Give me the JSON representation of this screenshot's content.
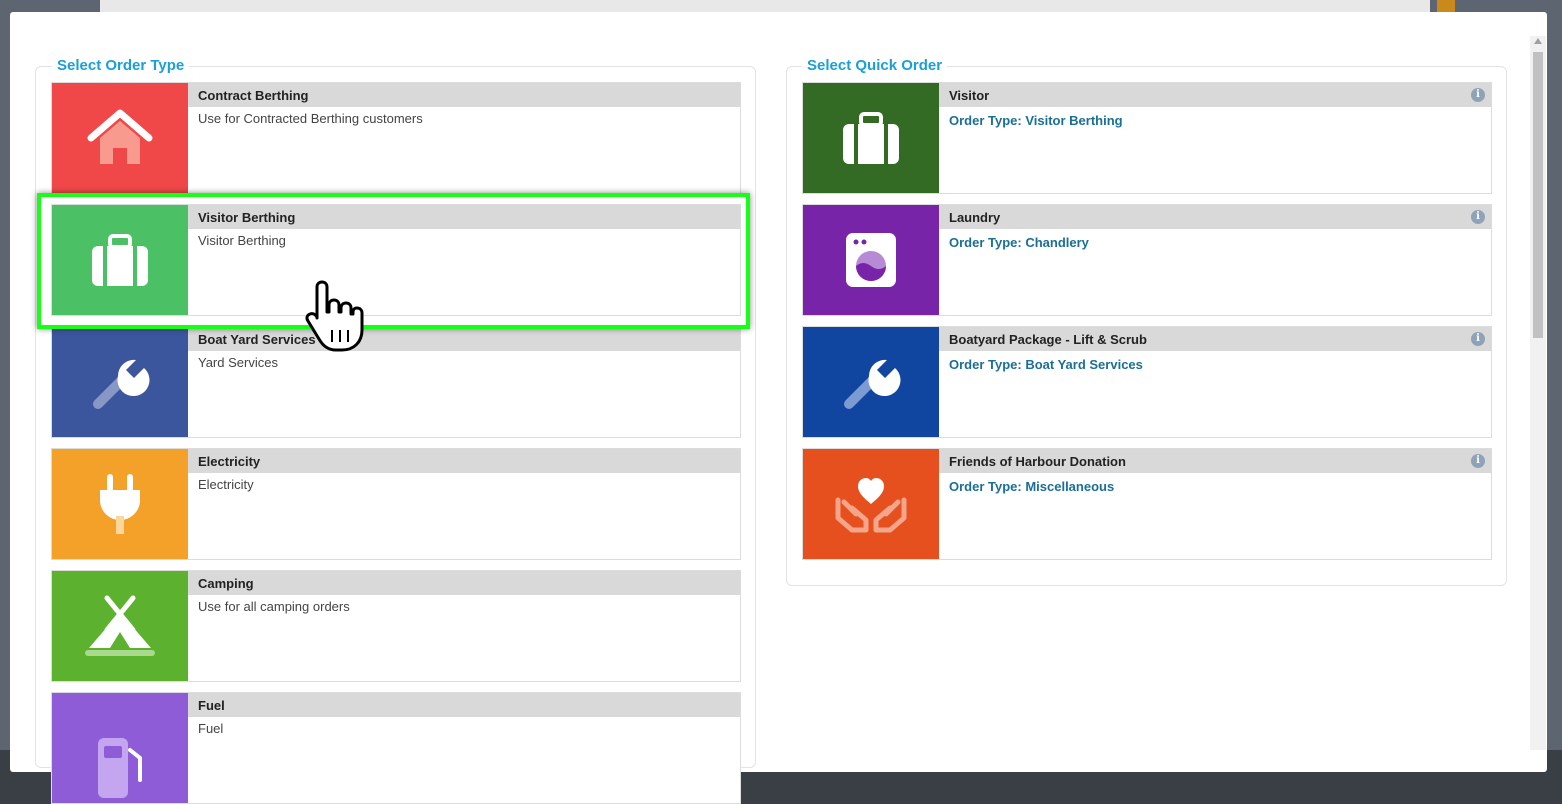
{
  "order_types": {
    "heading": "Select Order Type",
    "items": [
      {
        "title": "Contract Berthing",
        "description": "Use for Contracted Berthing customers",
        "color": "#f04848",
        "icon": "house-icon"
      },
      {
        "title": "Visitor Berthing",
        "description": "Visitor Berthing",
        "color": "#4cc064",
        "icon": "suitcase-icon"
      },
      {
        "title": "Boat Yard Services",
        "description": "Yard Services",
        "color": "#3c569e",
        "icon": "wrench-icon"
      },
      {
        "title": "Electricity",
        "description": "Electricity",
        "color": "#f4a12a",
        "icon": "plug-icon"
      },
      {
        "title": "Camping",
        "description": "Use for all camping orders",
        "color": "#5cb12f",
        "icon": "tent-icon"
      },
      {
        "title": "Fuel",
        "description": "Fuel",
        "color": "#8f5cd7",
        "icon": "fuel-pump-icon"
      }
    ]
  },
  "quick_orders": {
    "heading": "Select Quick Order",
    "items": [
      {
        "title": "Visitor",
        "order_type": "Order Type: Visitor Berthing",
        "color": "#336b25",
        "icon": "suitcase-icon"
      },
      {
        "title": "Laundry",
        "order_type": "Order Type: Chandlery",
        "color": "#7824a8",
        "icon": "washing-machine-icon"
      },
      {
        "title": "Boatyard Package - Lift & Scrub",
        "order_type": "Order Type: Boat Yard Services",
        "color": "#1045a0",
        "icon": "wrench-icon"
      },
      {
        "title": "Friends of Harbour Donation",
        "order_type": "Order Type: Miscellaneous",
        "color": "#e6501e",
        "icon": "heart-hands-icon"
      }
    ]
  },
  "info_glyph": "i",
  "highlight_color": "#16ff16"
}
